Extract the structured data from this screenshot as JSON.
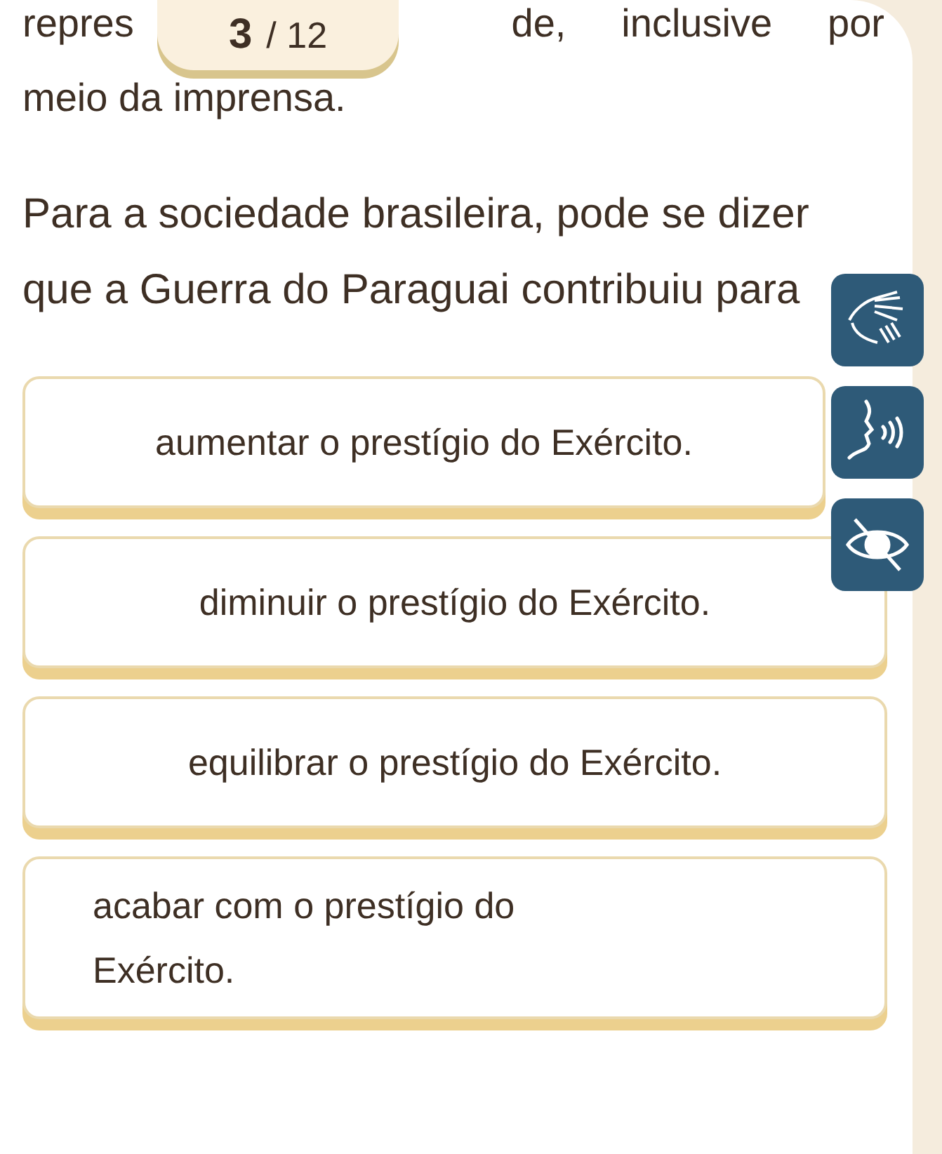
{
  "passage": {
    "first_line": [
      "repres",
      "de,",
      "inclusive",
      "por"
    ],
    "last_line": "meio da imprensa."
  },
  "counter": {
    "current": "3",
    "total": "/ 12"
  },
  "question": "Para a sociedade brasileira, pode se dizer que a Guerra do Paraguai contribuiu para",
  "tools": [
    {
      "kind": "sign"
    },
    {
      "kind": "audio"
    },
    {
      "kind": "hide"
    }
  ],
  "options": [
    {
      "text": "aumentar o prestígio do Exército.",
      "selected": false
    },
    {
      "text": "diminuir o prestígio do Exército.",
      "selected": false
    },
    {
      "text": "equilibrar o prestígio do Exército.",
      "selected": false
    },
    {
      "text": "acabar com o prestígio do Exército.",
      "selected": false
    }
  ]
}
